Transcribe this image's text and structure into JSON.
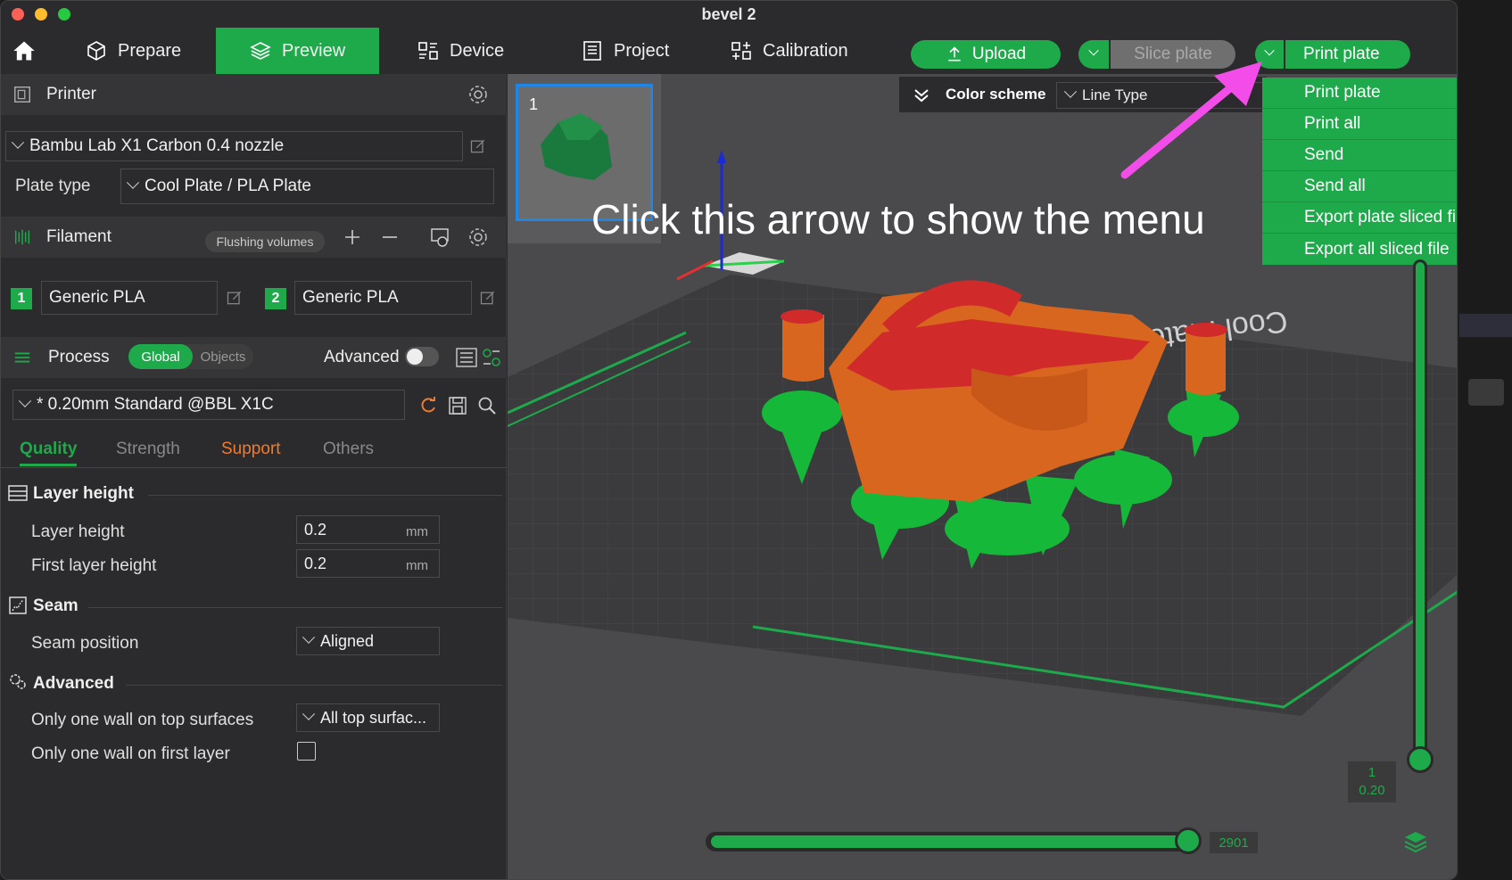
{
  "window": {
    "title": "bevel 2"
  },
  "nav": {
    "prepare": "Prepare",
    "preview": "Preview",
    "device": "Device",
    "project": "Project",
    "calibration": "Calibration"
  },
  "toolbar": {
    "upload": "Upload",
    "slice_plate": "Slice plate",
    "print_plate": "Print plate"
  },
  "printer": {
    "section": "Printer",
    "name": "Bambu Lab X1 Carbon 0.4 nozzle",
    "plate_type_label": "Plate type",
    "plate_type": "Cool Plate / PLA Plate"
  },
  "filament": {
    "section": "Filament",
    "flushing": "Flushing volumes",
    "items": [
      {
        "num": "1",
        "name": "Generic PLA"
      },
      {
        "num": "2",
        "name": "Generic PLA"
      }
    ]
  },
  "process": {
    "section": "Process",
    "global": "Global",
    "objects": "Objects",
    "advanced": "Advanced",
    "advanced_enabled": false,
    "preset": "* 0.20mm Standard @BBL X1C",
    "tabs": [
      "Quality",
      "Strength",
      "Support",
      "Others"
    ],
    "groups": {
      "layer_height": {
        "title": "Layer height",
        "layer_height_label": "Layer height",
        "layer_height_value": "0.2",
        "first_layer_label": "First layer height",
        "first_layer_value": "0.2",
        "unit": "mm"
      },
      "seam": {
        "title": "Seam",
        "position_label": "Seam position",
        "position_value": "Aligned"
      },
      "advanced": {
        "title": "Advanced",
        "top_wall_label": "Only one wall on top surfaces",
        "top_wall_value": "All top surfac...",
        "first_layer_wall_label": "Only one wall on first layer",
        "first_layer_wall_checked": false
      }
    }
  },
  "viewport": {
    "plate_thumb_number": "1",
    "color_scheme_label": "Color scheme",
    "color_scheme_value": "Line Type",
    "annotation": "Click this arrow to show the menu",
    "bed_text": "Cool Plate",
    "layer_label_top": "1",
    "layer_label_bottom": "0.20",
    "move_value": "2901"
  },
  "print_menu": [
    "Print plate",
    "Print all",
    "Send",
    "Send all",
    "Export plate sliced file",
    "Export all sliced file"
  ],
  "colors": {
    "accent": "#1eaa4b",
    "support_orange": "#ef7b2f",
    "annotation_arrow": "#f24de8"
  }
}
